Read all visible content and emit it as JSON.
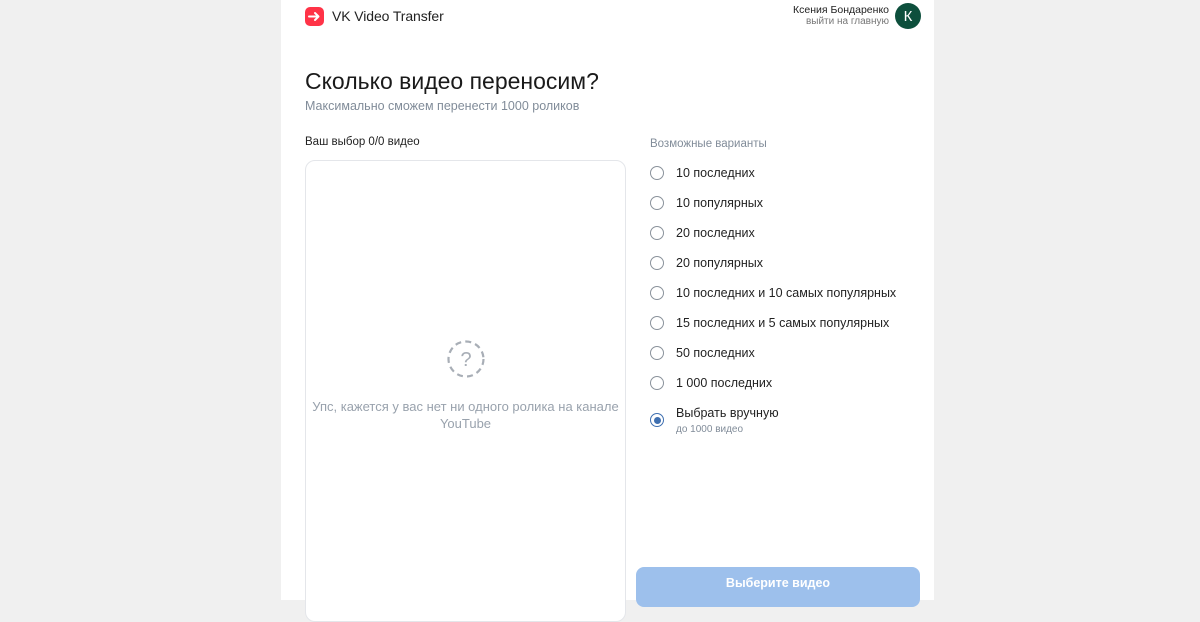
{
  "header": {
    "app_name": "VK Video Transfer",
    "user_name": "Ксения Бондаренко",
    "logout_label": "выйти на главную",
    "avatar_letter": "К"
  },
  "main": {
    "title": "Сколько видео переносим?",
    "subtitle": "Максимально сможем перенести 1000 роликов",
    "choice_label": "Ваш выбор 0/0 видео",
    "empty_icon": "question-circle-dashed-icon",
    "empty_text": "Упс, кажется у вас нет ни одного ролика на канале YouTube"
  },
  "options": {
    "title": "Возможные варианты",
    "items": [
      {
        "label": "10 последних",
        "checked": false
      },
      {
        "label": "10 популярных",
        "checked": false
      },
      {
        "label": "20 последних",
        "checked": false
      },
      {
        "label": "20 популярных",
        "checked": false
      },
      {
        "label": "10 последних и 10 самых популярных",
        "checked": false
      },
      {
        "label": "15 последних и 5 самых популярных",
        "checked": false
      },
      {
        "label": "50 последних",
        "checked": false
      },
      {
        "label": "1 000 последних",
        "checked": false
      },
      {
        "label": "Выбрать вручную",
        "hint": "до 1000 видео",
        "checked": true
      }
    ]
  },
  "submit": {
    "label": "Выберите видео",
    "disabled": true
  },
  "colors": {
    "brand": "#ff3347",
    "accent": "#3f6fb0",
    "avatar_bg": "#0d4f3c",
    "button_disabled": "#9dc0ec"
  }
}
